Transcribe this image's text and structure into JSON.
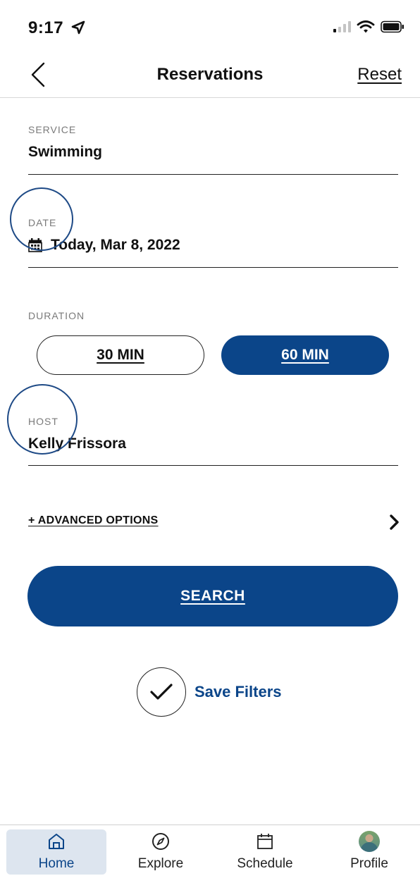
{
  "status_bar": {
    "time": "9:17"
  },
  "header": {
    "title": "Reservations",
    "reset_label": "Reset"
  },
  "service": {
    "label": "SERVICE",
    "value": "Swimming"
  },
  "date": {
    "label": "DATE",
    "value": "Today, Mar 8, 2022"
  },
  "duration": {
    "label": "DURATION",
    "options": [
      {
        "label": "30 MIN",
        "selected": false
      },
      {
        "label": "60 MIN",
        "selected": true
      }
    ]
  },
  "host": {
    "label": "HOST",
    "value": "Kelly Frissora"
  },
  "advanced_options": {
    "label": "+ ADVANCED OPTIONS"
  },
  "search": {
    "label": "SEARCH"
  },
  "save_filters": {
    "label": "Save Filters"
  },
  "tabs": [
    {
      "label": "Home",
      "icon": "home-icon",
      "active": true
    },
    {
      "label": "Explore",
      "icon": "compass-icon",
      "active": false
    },
    {
      "label": "Schedule",
      "icon": "calendar-icon",
      "active": false
    },
    {
      "label": "Profile",
      "icon": "avatar",
      "active": false
    }
  ],
  "colors": {
    "primary": "#0b4589",
    "active_tab_bg": "#dde5ef"
  }
}
